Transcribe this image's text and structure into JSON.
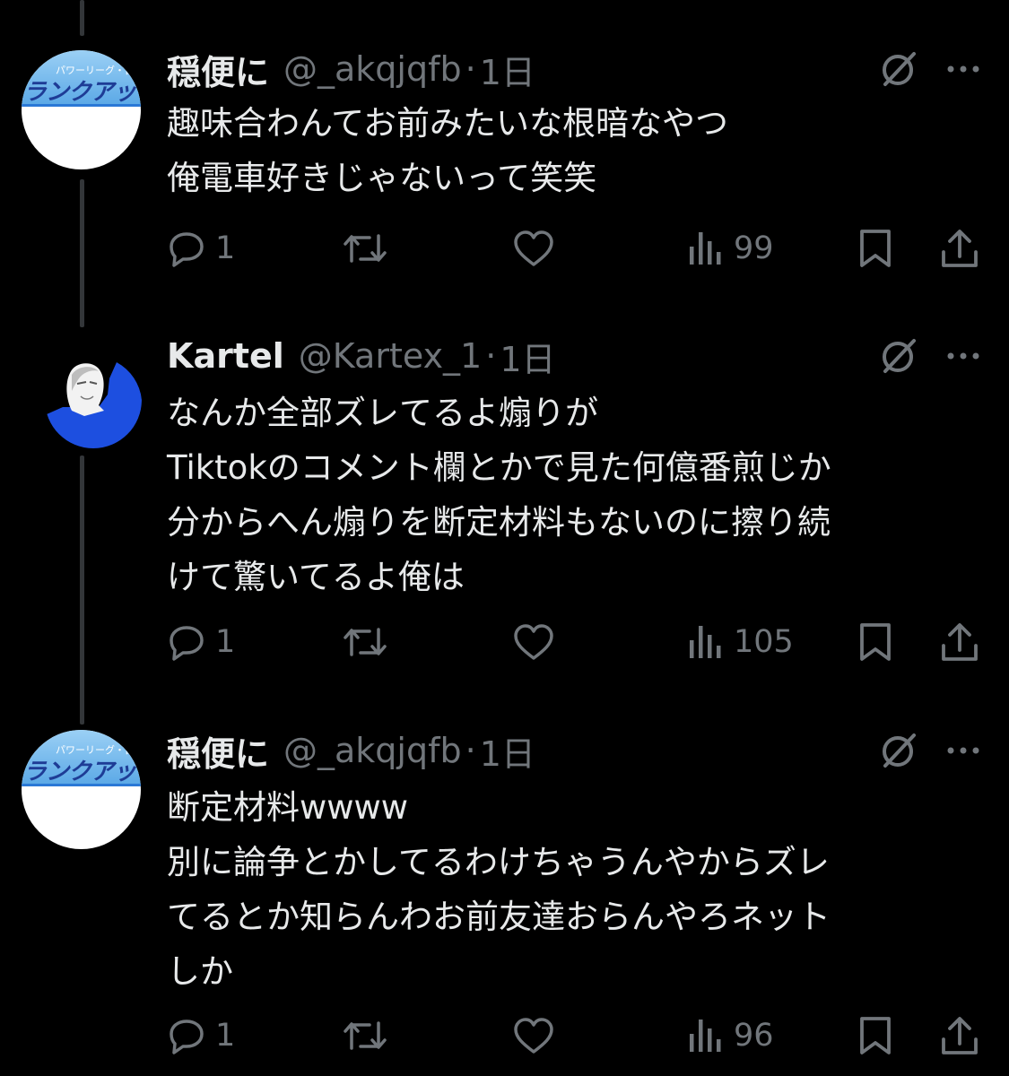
{
  "colors": {
    "background": "#000000",
    "primary_text": "#e7e9ea",
    "secondary_text": "#71767b",
    "thread_line": "#333639",
    "avatar_accent": "#1d4fe0"
  },
  "icons": {
    "reply": "reply-icon",
    "retweet": "retweet-icon",
    "like": "heart-icon",
    "views": "views-icon",
    "bookmark": "bookmark-icon",
    "share": "share-icon",
    "grok": "grok-icon",
    "more": "more-icon"
  },
  "tweets": [
    {
      "display_name": "穏便に",
      "handle": "@_akqjqfb",
      "separator": "·",
      "time": "1日",
      "avatar": {
        "banner_top": "パワーリーグ・自己紹",
        "banner_text": "ランクアッ"
      },
      "lines": [
        "趣味合わんてお前みたいな根暗なやつ",
        "俺電車好きじゃないって笑笑"
      ],
      "replies": "1",
      "retweets": "",
      "likes": "",
      "views": "99"
    },
    {
      "display_name": "Kartel",
      "handle": "@Kartex_1",
      "separator": "·",
      "time": "1日",
      "lines": [
        "なんか全部ズレてるよ煽りが",
        "Tiktokのコメント欄とかで見た何億番煎じか",
        "分からへん煽りを断定材料もないのに擦り続",
        "けて驚いてるよ俺は"
      ],
      "replies": "1",
      "retweets": "",
      "likes": "",
      "views": "105"
    },
    {
      "display_name": "穏便に",
      "handle": "@_akqjqfb",
      "separator": "·",
      "time": "1日",
      "avatar": {
        "banner_top": "パワーリーグ・自己紹",
        "banner_text": "ランクアッ"
      },
      "lines": [
        "断定材料wwww",
        "別に論争とかしてるわけちゃうんやからズレ",
        "てるとか知らんわお前友達おらんやろネット",
        "しか"
      ],
      "replies": "1",
      "retweets": "",
      "likes": "",
      "views": "96"
    }
  ]
}
